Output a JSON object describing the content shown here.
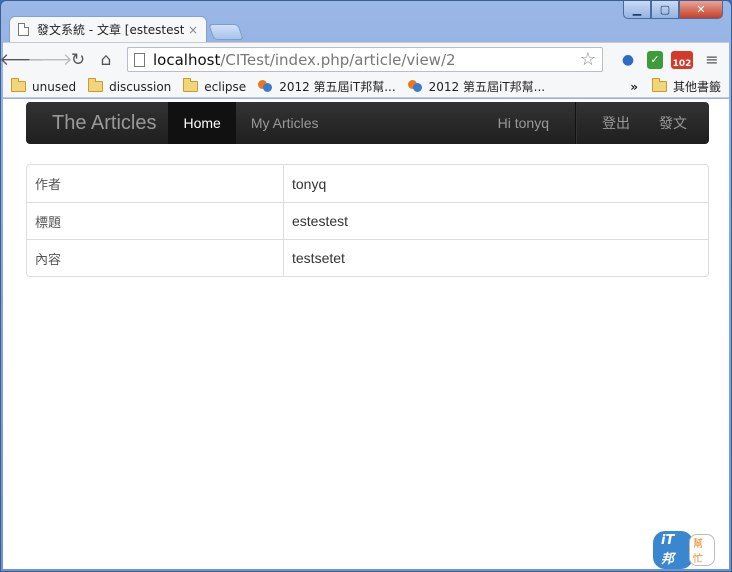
{
  "browser": {
    "tab_title": "發文系統 - 文章 [estestest]",
    "tab_close": "×",
    "url_host": "localhost",
    "url_path": "/CITest/index.php/article/view/2",
    "mail_badge": "102"
  },
  "bookmarks": [
    {
      "label": "unused",
      "type": "folder"
    },
    {
      "label": "discussion",
      "type": "folder"
    },
    {
      "label": "eclipse",
      "type": "folder"
    },
    {
      "label": "2012 第五屆iT邦幫...",
      "type": "ithelp"
    },
    {
      "label": "2012 第五屆iT邦幫...",
      "type": "ithelp"
    }
  ],
  "bookmarks_more": "»",
  "bookmarks_other": "其他書籤",
  "navbar": {
    "brand": "The Articles",
    "home": "Home",
    "my_articles": "My Articles",
    "greeting": "Hi tonyq",
    "logout": "登出",
    "post": "發文"
  },
  "article": {
    "rows": [
      {
        "key": "作者",
        "value": "tonyq"
      },
      {
        "key": "標題",
        "value": "estestest"
      },
      {
        "key": "內容",
        "value": "testsetet"
      }
    ]
  },
  "watermark": {
    "badge": "iT邦",
    "cloud": "幫忙"
  }
}
